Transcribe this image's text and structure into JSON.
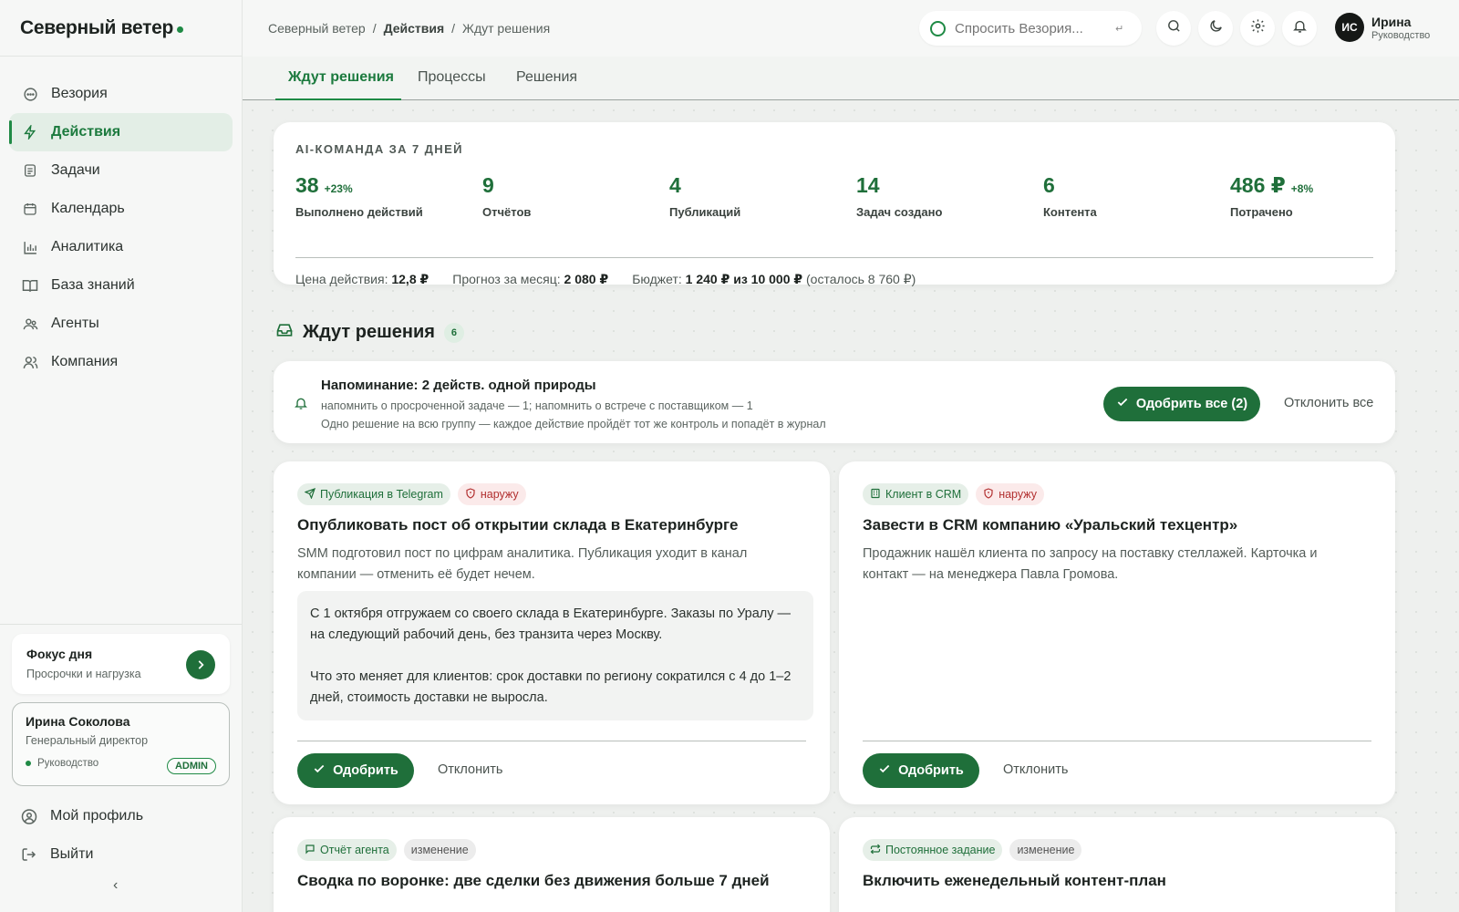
{
  "brand": "Северный ветер",
  "sidebar": {
    "items": [
      {
        "label": "Везория",
        "icon": "chat-icon"
      },
      {
        "label": "Действия",
        "icon": "bolt-icon"
      },
      {
        "label": "Задачи",
        "icon": "tasks-icon"
      },
      {
        "label": "Календарь",
        "icon": "calendar-icon"
      },
      {
        "label": "Аналитика",
        "icon": "chart-icon"
      },
      {
        "label": "База знаний",
        "icon": "book-icon"
      },
      {
        "label": "Агенты",
        "icon": "agents-icon"
      },
      {
        "label": "Компания",
        "icon": "company-icon"
      }
    ],
    "focus": {
      "title": "Фокус дня",
      "subtitle": "Просрочки и нагрузка"
    },
    "user": {
      "name": "Ирина Соколова",
      "role": "Генеральный директор",
      "dept": "Руководство",
      "badge": "ADMIN"
    },
    "profile": "Мой профиль",
    "logout": "Выйти",
    "collapse": "‹"
  },
  "breadcrumb": {
    "a": "Северный ветер",
    "b": "Действия",
    "c": "Ждут решения"
  },
  "ask": {
    "placeholder": "Спросить Везория...",
    "hint": "↵"
  },
  "topuser": {
    "initials": "ИС",
    "name": "Ирина",
    "role": "Руководство"
  },
  "tabs": [
    "Ждут решения",
    "Процессы",
    "Решения"
  ],
  "stats": {
    "label": "AI-КОМАНДА ЗА 7 ДНЕЙ",
    "items": [
      {
        "v": "38",
        "d": "+23%",
        "c": "Выполнено действий"
      },
      {
        "v": "9",
        "d": "",
        "c": "Отчётов"
      },
      {
        "v": "4",
        "d": "",
        "c": "Публикаций"
      },
      {
        "v": "14",
        "d": "",
        "c": "Задач создано"
      },
      {
        "v": "6",
        "d": "",
        "c": "Контента"
      },
      {
        "v": "486 ₽",
        "d": "+8%",
        "c": "Потрачено"
      }
    ],
    "price_label": "Цена действия:",
    "price": "12,8 ₽",
    "forecast_label": "Прогноз за месяц:",
    "forecast": "2 080 ₽",
    "budget_label": "Бюджет:",
    "budget": "1 240 ₽ из 10 000 ₽",
    "budget_left": "(осталось 8 760 ₽)"
  },
  "section": {
    "title": "Ждут решения",
    "count": "6"
  },
  "reminder": {
    "title": "Напоминание: 2 действ. одной природы",
    "line1": "напомнить о просроченной задаче — 1; напомнить о встрече с поставщиком — 1",
    "line2": "Одно решение на всю группу — каждое действие пройдёт тот же контроль и попадёт в журнал",
    "approve_all": "Одобрить все (2)",
    "reject_all": "Отклонить все"
  },
  "actions": [
    {
      "tag1": "Публикация в Telegram",
      "tag2": "наружу",
      "title": "Опубликовать пост об открытии склада в Екатеринбурге",
      "desc": "SMM подготовил пост по цифрам аналитика. Публикация уходит в канал компании — отменить её будет нечем.",
      "preview_p1": "С 1 октября отгружаем со своего склада в Екатеринбурге. Заказы по Уралу — на следующий рабочий день, без транзита через Москву.",
      "preview_p2": "Что это меняет для клиентов: срок доставки по региону сократился с 4 до 1–2 дней, стоимость доставки не выросла.",
      "approve": "Одобрить",
      "reject": "Отклонить"
    },
    {
      "tag1": "Клиент в CRM",
      "tag2": "наружу",
      "title": "Завести в CRM компанию «Уральский техцентр»",
      "desc": "Продажник нашёл клиента по запросу на поставку стеллажей. Карточка и контакт — на менеджера Павла Громова.",
      "approve": "Одобрить",
      "reject": "Отклонить"
    },
    {
      "tag1": "Отчёт агента",
      "tag2": "изменение",
      "title": "Сводка по воронке: две сделки без движения больше 7 дней"
    },
    {
      "tag1": "Постоянное задание",
      "tag2": "изменение",
      "title": "Включить еженедельный контент-план"
    }
  ],
  "colors": {
    "accent": "#1f8a45",
    "accent_dark": "#1f6f3a",
    "danger": "#b23030"
  }
}
